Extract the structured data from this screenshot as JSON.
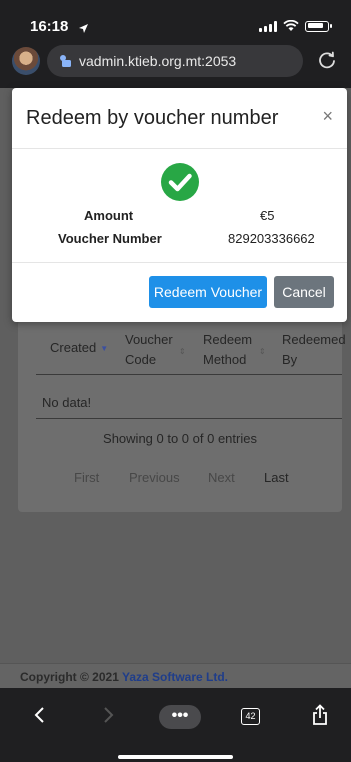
{
  "status_bar": {
    "time": "16:18"
  },
  "browser": {
    "url": "vadmin.ktieb.org.mt:2053"
  },
  "table": {
    "headers": [
      {
        "line1": "Created",
        "line2": ""
      },
      {
        "line1": "Voucher",
        "line2": "Code"
      },
      {
        "line1": "Redeem",
        "line2": "Method"
      },
      {
        "line1": "Redeemed",
        "line2": "By"
      }
    ],
    "empty_text": "No data!",
    "info_text": "Showing 0 to 0 of 0 entries",
    "pagination": {
      "first": "First",
      "previous": "Previous",
      "next": "Next",
      "last": "Last"
    }
  },
  "footer": {
    "prefix": "Copyright © 2021 ",
    "brand": "Yaza Software Ltd."
  },
  "modal": {
    "title": "Redeem by voucher number",
    "close": "×",
    "amount_label": "Amount",
    "amount_value": "€5",
    "voucher_label": "Voucher Number",
    "voucher_value": "829203336662",
    "confirm_button": "Redeem Voucher",
    "cancel_button": "Cancel"
  },
  "toolbar": {
    "tab_count": "42",
    "more": "•••"
  },
  "colors": {
    "primary": "#1e90e8",
    "secondary": "#6c757d",
    "success": "#28a745",
    "brand_link": "#1f3d8a"
  },
  "icons": [
    "back-icon",
    "forward-icon",
    "more-icon",
    "tabs-icon",
    "share-icon",
    "reload-icon",
    "lock-icon",
    "check-circle-icon"
  ]
}
